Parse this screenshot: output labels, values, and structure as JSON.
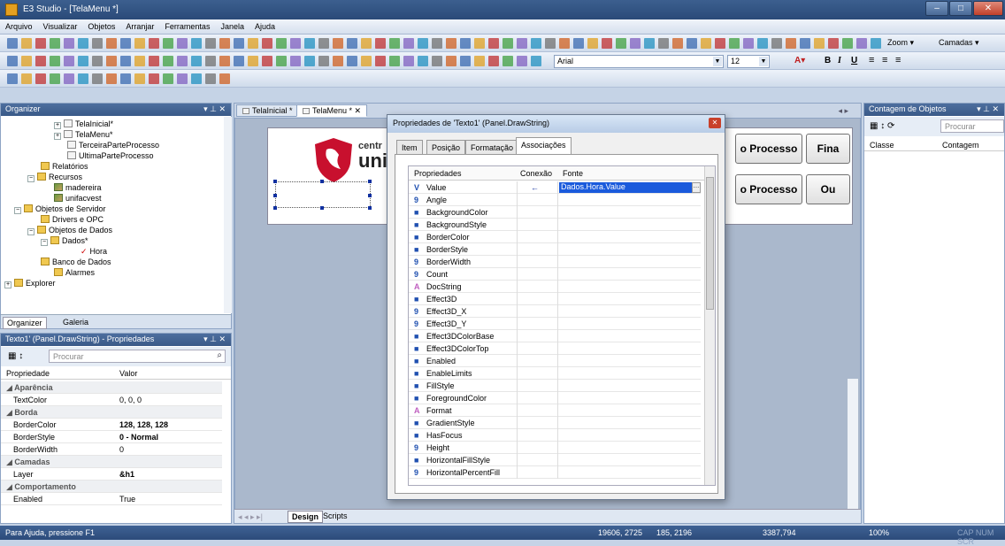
{
  "window": {
    "title": "E3 Studio - [TelaMenu *]"
  },
  "menu": [
    "Arquivo",
    "Visualizar",
    "Objetos",
    "Arranjar",
    "Ferramentas",
    "Janela",
    "Ajuda"
  ],
  "toolbar": {
    "zoom_label": "Zoom",
    "camadas_label": "Camadas",
    "font_name": "Arial",
    "font_size": "12",
    "bold": "B",
    "italic": "I",
    "underline": "U"
  },
  "organizer": {
    "title": "Organizer",
    "items": [
      "TelaInicial*",
      "TelaMenu*",
      "TerceiraParteProcesso",
      "UltimaParteProcesso",
      "Relatórios",
      "Recursos",
      "madereira",
      "unifacvest",
      "Objetos de Servidor",
      "Drivers e OPC",
      "Objetos de Dados",
      "Dados*",
      "Hora",
      "Banco de Dados",
      "Alarmes",
      "Explorer"
    ],
    "tabs": [
      "Organizer",
      "Galeria"
    ]
  },
  "props": {
    "title": "Texto1' (Panel.DrawString) - Propriedades",
    "search_placeholder": "Procurar",
    "col_prop": "Propriedade",
    "col_val": "Valor",
    "rows": [
      {
        "cat": "Aparência"
      },
      {
        "name": "TextColor",
        "value": "0, 0, 0"
      },
      {
        "cat": "Borda"
      },
      {
        "name": "BorderColor",
        "value": "128, 128, 128"
      },
      {
        "name": "BorderStyle",
        "value": "0 - Normal"
      },
      {
        "name": "BorderWidth",
        "value": "0"
      },
      {
        "cat": "Camadas"
      },
      {
        "name": "Layer",
        "value": "&h1"
      },
      {
        "cat": "Comportamento"
      },
      {
        "name": "Enabled",
        "value": "True"
      }
    ]
  },
  "doc": {
    "tabs": [
      "TelaInicial *",
      "TelaMenu *"
    ],
    "logo_text1": "centr",
    "logo_text2": "uni",
    "buttons": [
      "o Processo",
      "Fina",
      "o Processo",
      "Ou"
    ],
    "bottom_tabs": [
      "Design",
      "Scripts"
    ]
  },
  "dialog": {
    "title": "Propriedades de 'Texto1' (Panel.DrawString)",
    "tabs": [
      "Item",
      "Posição",
      "Formatação",
      "Associações"
    ],
    "headers": [
      "Propriedades",
      "Conexão",
      "Fonte"
    ],
    "rows": [
      {
        "name": "Value",
        "conn": "←",
        "src": "Dados.Hora.Value"
      },
      {
        "name": "Angle"
      },
      {
        "name": "BackgroundColor"
      },
      {
        "name": "BackgroundStyle"
      },
      {
        "name": "BorderColor"
      },
      {
        "name": "BorderStyle"
      },
      {
        "name": "BorderWidth"
      },
      {
        "name": "Count"
      },
      {
        "name": "DocString"
      },
      {
        "name": "Effect3D"
      },
      {
        "name": "Effect3D_X"
      },
      {
        "name": "Effect3D_Y"
      },
      {
        "name": "Effect3DColorBase"
      },
      {
        "name": "Effect3DColorTop"
      },
      {
        "name": "Enabled"
      },
      {
        "name": "EnableLimits"
      },
      {
        "name": "FillStyle"
      },
      {
        "name": "ForegroundColor"
      },
      {
        "name": "Format"
      },
      {
        "name": "GradientStyle"
      },
      {
        "name": "HasFocus"
      },
      {
        "name": "Height"
      },
      {
        "name": "HorizontalFillStyle"
      },
      {
        "name": "HorizontalPercentFill"
      }
    ]
  },
  "counter": {
    "title": "Contagem de Objetos",
    "search_placeholder": "Procurar",
    "col1": "Classe",
    "col2": "Contagem"
  },
  "status": {
    "help": "Para Ajuda, pressione F1",
    "coords": "19606, 2725",
    "size": "185, 2196",
    "dims": "3387,794",
    "zoom": "100%",
    "caps": "CAP NUM SCR"
  }
}
